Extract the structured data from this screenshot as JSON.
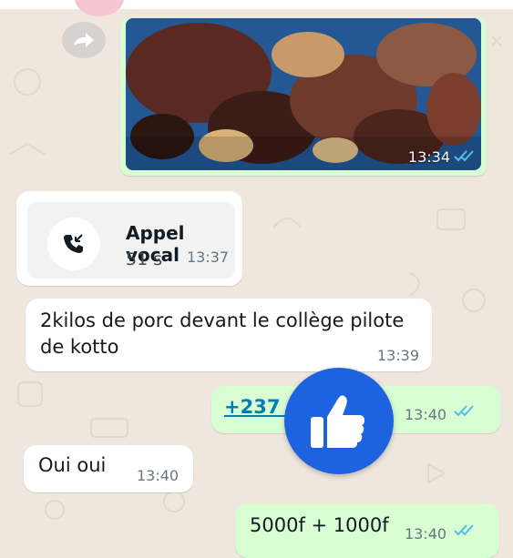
{
  "messages": {
    "photo": {
      "time": "13:34",
      "status": "read"
    },
    "call": {
      "title": "Appel vocal",
      "duration": "51 s",
      "time": "13:37"
    },
    "porc": {
      "text": "2kilos de porc devant le collège pilote de kotto",
      "time": "13:39"
    },
    "phone": {
      "text": "+237 6",
      "time": "13:40",
      "status": "read"
    },
    "oui": {
      "text": "Oui oui",
      "time": "13:40"
    },
    "price": {
      "text": "5000f + 1000f",
      "time": "13:40",
      "status": "read"
    }
  },
  "icons": {
    "forward": "forward-icon",
    "call": "incoming-call-icon",
    "like": "thumbs-up-icon",
    "ticks": "double-check-icon"
  },
  "colors": {
    "chat_background": "#efe7dd",
    "incoming_bubble": "#ffffff",
    "outgoing_bubble": "#d9fdd3",
    "link": "#027eb5",
    "read_ticks": "#53bdeb",
    "like_button": "#1d63e0"
  }
}
